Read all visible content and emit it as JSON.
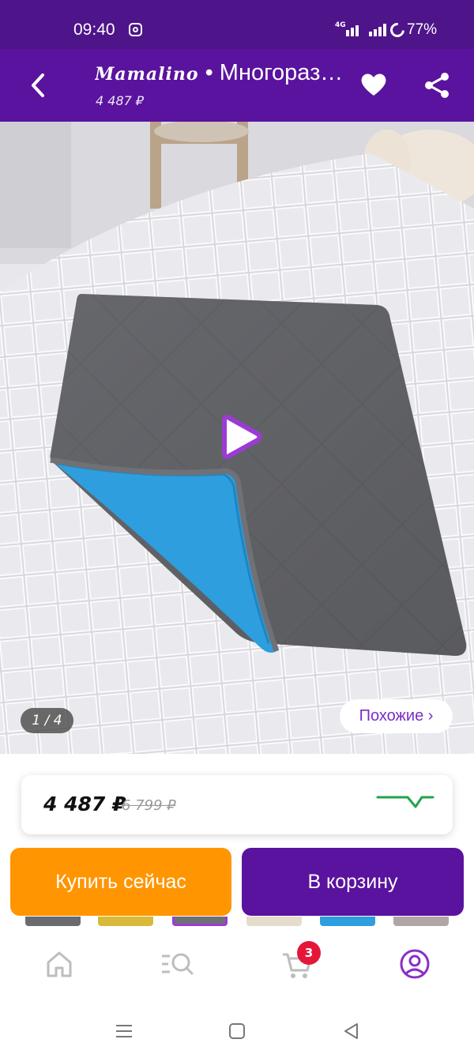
{
  "status_bar": {
    "time": "09:40",
    "network": "4G",
    "battery": "77%",
    "icons": [
      "instagram-icon",
      "signal-icon",
      "battery-icon"
    ]
  },
  "header": {
    "brand": "Mamalino",
    "title": " • Многоразовая пеленка",
    "price": "4 487 ₽",
    "icons": [
      "back-icon",
      "heart-icon",
      "share-icon"
    ]
  },
  "gallery": {
    "counter": "1 / 4",
    "similar_label": "Похожие ›",
    "icons": [
      "play-icon"
    ]
  },
  "price_card": {
    "current": "4 487 ₽",
    "old": "6 799 ₽",
    "icons": [
      "price-history-chart-icon"
    ]
  },
  "actions": {
    "buy_now": "Купить сейчас",
    "add_to_cart": "В корзину"
  },
  "bottom_nav": {
    "items": [
      "home-icon",
      "catalog-search-icon",
      "cart-icon",
      "profile-icon"
    ],
    "cart_count": "3"
  },
  "system_nav": {
    "items": [
      "recents-icon",
      "home-square-icon",
      "back-triangle-icon"
    ]
  },
  "colors": {
    "header": "#5a139e",
    "status_bar": "#4e1489",
    "buy_button": "#ff9500",
    "cart_button": "#5a139e",
    "badge": "#e4173b",
    "accent": "#7b2ec2"
  }
}
